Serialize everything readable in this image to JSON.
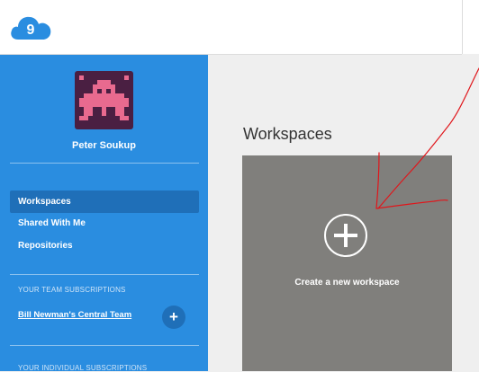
{
  "app": {
    "logo_text": "9"
  },
  "sidebar": {
    "user_name": "Peter Soukup",
    "nav": [
      {
        "label": "Workspaces",
        "active": true
      },
      {
        "label": "Shared With Me",
        "active": false
      },
      {
        "label": "Repositories",
        "active": false
      }
    ],
    "team_subscriptions_title": "YOUR TEAM SUBSCRIPTIONS",
    "team_name": "Bill Newman's Central Team",
    "add_symbol": "+",
    "individual_subscriptions_title": "YOUR INDIVIDUAL SUBSCRIPTIONS"
  },
  "main": {
    "title": "Workspaces",
    "create_label": "Create a new workspace"
  },
  "colors": {
    "sidebar": "#2a8de0",
    "sidebar_active": "#1f6fb8",
    "card": "#807f7c",
    "annotation": "#e0161b",
    "avatar_bg": "#4a1f42",
    "avatar_fg": "#e86a8f"
  }
}
